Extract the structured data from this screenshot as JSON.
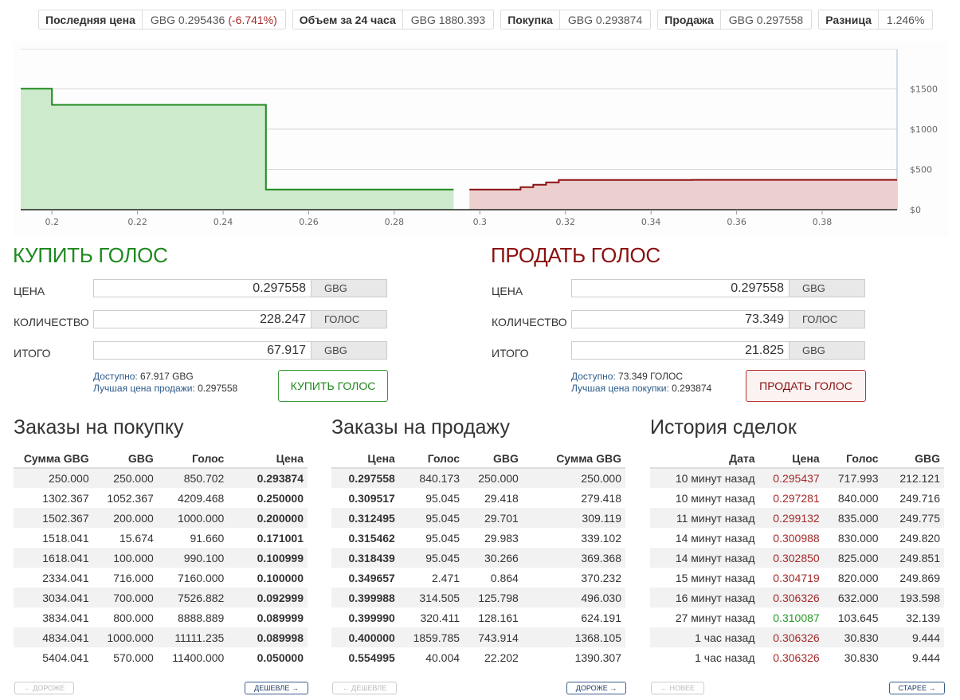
{
  "ticker": [
    {
      "label": "Последняя цена",
      "value": "GBG 0.295436",
      "change": "(-6.741%)"
    },
    {
      "label": "Объем за 24 часа",
      "value": "GBG 1880.393"
    },
    {
      "label": "Покупка",
      "value": "GBG 0.293874"
    },
    {
      "label": "Продажа",
      "value": "GBG 0.297558"
    },
    {
      "label": "Разница",
      "value": "1.246%"
    }
  ],
  "chart_data": {
    "type": "area",
    "x_ticks": [
      0.2,
      0.22,
      0.24,
      0.26,
      0.28,
      0.3,
      0.32,
      0.34,
      0.36,
      0.38
    ],
    "x_tick_labels": [
      "0.2",
      "0.22",
      "0.24",
      "0.26",
      "0.28",
      "0.3",
      "0.32",
      "0.34",
      "0.36",
      "0.38"
    ],
    "y_ticks": [
      0,
      500,
      1000,
      1500
    ],
    "y_tick_labels": [
      "$0",
      "$500",
      "$1000",
      "$1500"
    ],
    "xlim": [
      0.1927,
      0.3975
    ],
    "ylim": [
      0,
      1990
    ],
    "y_axis_side": "right",
    "grid": true,
    "series": [
      {
        "color": "#1f8a1f",
        "fill": "#cdeacd",
        "x": [
          0.1927,
          0.2,
          0.2,
          0.25,
          0.25,
          0.293874
        ],
        "y": [
          1502.4,
          1502.4,
          1302.4,
          1302.4,
          250,
          250
        ]
      },
      {
        "color": "#8b1010",
        "fill": "#ecd0d0",
        "x": [
          0.297558,
          0.309517,
          0.309517,
          0.312495,
          0.312495,
          0.315462,
          0.315462,
          0.318439,
          0.318439,
          0.349657,
          0.349657,
          0.3975
        ],
        "y": [
          250,
          250,
          279.4,
          279.4,
          309.1,
          309.1,
          339.1,
          339.1,
          369.4,
          369.4,
          370.2,
          370.2
        ]
      }
    ]
  },
  "buy": {
    "title": "КУПИТЬ ГОЛОС",
    "price_label": "ЦЕНА",
    "price": "0.297558",
    "price_unit": "GBG",
    "amount_label": "КОЛИЧЕСТВО",
    "amount": "228.247",
    "amount_unit": "ГОЛОС",
    "total_label": "ИТОГО",
    "total": "67.917",
    "total_unit": "GBG",
    "avail_label": "Доступно:",
    "avail_value": "67.917 GBG",
    "best_label": "Лучшая цена продажи:",
    "best_value": "0.297558",
    "button": "КУПИТЬ ГОЛОС"
  },
  "sell": {
    "title": "ПРОДАТЬ ГОЛОС",
    "price_label": "ЦЕНА",
    "price": "0.297558",
    "price_unit": "GBG",
    "amount_label": "КОЛИЧЕСТВО",
    "amount": "73.349",
    "amount_unit": "ГОЛОС",
    "total_label": "ИТОГО",
    "total": "21.825",
    "total_unit": "GBG",
    "avail_label": "Доступно:",
    "avail_value": "73.349 ГОЛОС",
    "best_label": "Лучшая цена покупки:",
    "best_value": "0.293874",
    "button": "ПРОДАТЬ ГОЛОС"
  },
  "bids": {
    "title": "Заказы на покупку",
    "headers": [
      "Сумма GBG",
      "GBG",
      "Голос",
      "Цена"
    ],
    "rows": [
      [
        "250.000",
        "250.000",
        "850.702",
        "0.293874"
      ],
      [
        "1302.367",
        "1052.367",
        "4209.468",
        "0.250000"
      ],
      [
        "1502.367",
        "200.000",
        "1000.000",
        "0.200000"
      ],
      [
        "1518.041",
        "15.674",
        "91.660",
        "0.171001"
      ],
      [
        "1618.041",
        "100.000",
        "990.100",
        "0.100999"
      ],
      [
        "2334.041",
        "716.000",
        "7160.000",
        "0.100000"
      ],
      [
        "3034.041",
        "700.000",
        "7526.882",
        "0.092999"
      ],
      [
        "3834.041",
        "800.000",
        "8888.889",
        "0.089999"
      ],
      [
        "4834.041",
        "1000.000",
        "11111.235",
        "0.089998"
      ],
      [
        "5404.041",
        "570.000",
        "11400.000",
        "0.050000"
      ]
    ],
    "prev": "← ДОРОЖЕ",
    "next": "ДЕШЕВЛЕ →"
  },
  "asks": {
    "title": "Заказы на продажу",
    "headers": [
      "Цена",
      "Голос",
      "GBG",
      "Сумма GBG"
    ],
    "rows": [
      [
        "0.297558",
        "840.173",
        "250.000",
        "250.000"
      ],
      [
        "0.309517",
        "95.045",
        "29.418",
        "279.418"
      ],
      [
        "0.312495",
        "95.045",
        "29.701",
        "309.119"
      ],
      [
        "0.315462",
        "95.045",
        "29.983",
        "339.102"
      ],
      [
        "0.318439",
        "95.045",
        "30.266",
        "369.368"
      ],
      [
        "0.349657",
        "2.471",
        "0.864",
        "370.232"
      ],
      [
        "0.399988",
        "314.505",
        "125.798",
        "496.030"
      ],
      [
        "0.399990",
        "320.411",
        "128.161",
        "624.191"
      ],
      [
        "0.400000",
        "1859.785",
        "743.914",
        "1368.105"
      ],
      [
        "0.554995",
        "40.004",
        "22.202",
        "1390.307"
      ]
    ],
    "prev": "← ДЕШЕВЛЕ",
    "next": "ДОРОЖЕ →"
  },
  "history": {
    "title": "История сделок",
    "headers": [
      "Дата",
      "Цена",
      "Голос",
      "GBG"
    ],
    "rows": [
      {
        "cells": [
          "10 минут назад",
          "0.295437",
          "717.993",
          "212.121"
        ],
        "dir": "red"
      },
      {
        "cells": [
          "10 минут назад",
          "0.297281",
          "840.000",
          "249.716"
        ],
        "dir": "red"
      },
      {
        "cells": [
          "11 минут назад",
          "0.299132",
          "835.000",
          "249.775"
        ],
        "dir": "red"
      },
      {
        "cells": [
          "14 минут назад",
          "0.300988",
          "830.000",
          "249.820"
        ],
        "dir": "red"
      },
      {
        "cells": [
          "14 минут назад",
          "0.302850",
          "825.000",
          "249.851"
        ],
        "dir": "red"
      },
      {
        "cells": [
          "15 минут назад",
          "0.304719",
          "820.000",
          "249.869"
        ],
        "dir": "red"
      },
      {
        "cells": [
          "16 минут назад",
          "0.306326",
          "632.000",
          "193.598"
        ],
        "dir": "red"
      },
      {
        "cells": [
          "27 минут назад",
          "0.310087",
          "103.645",
          "32.139"
        ],
        "dir": "green"
      },
      {
        "cells": [
          "1 час назад",
          "0.306326",
          "30.830",
          "9.444"
        ],
        "dir": "red"
      },
      {
        "cells": [
          "1 час назад",
          "0.306326",
          "30.830",
          "9.444"
        ],
        "dir": "red"
      }
    ],
    "prev": "← НОВЕЕ",
    "next": "СТАРЕЕ →"
  }
}
